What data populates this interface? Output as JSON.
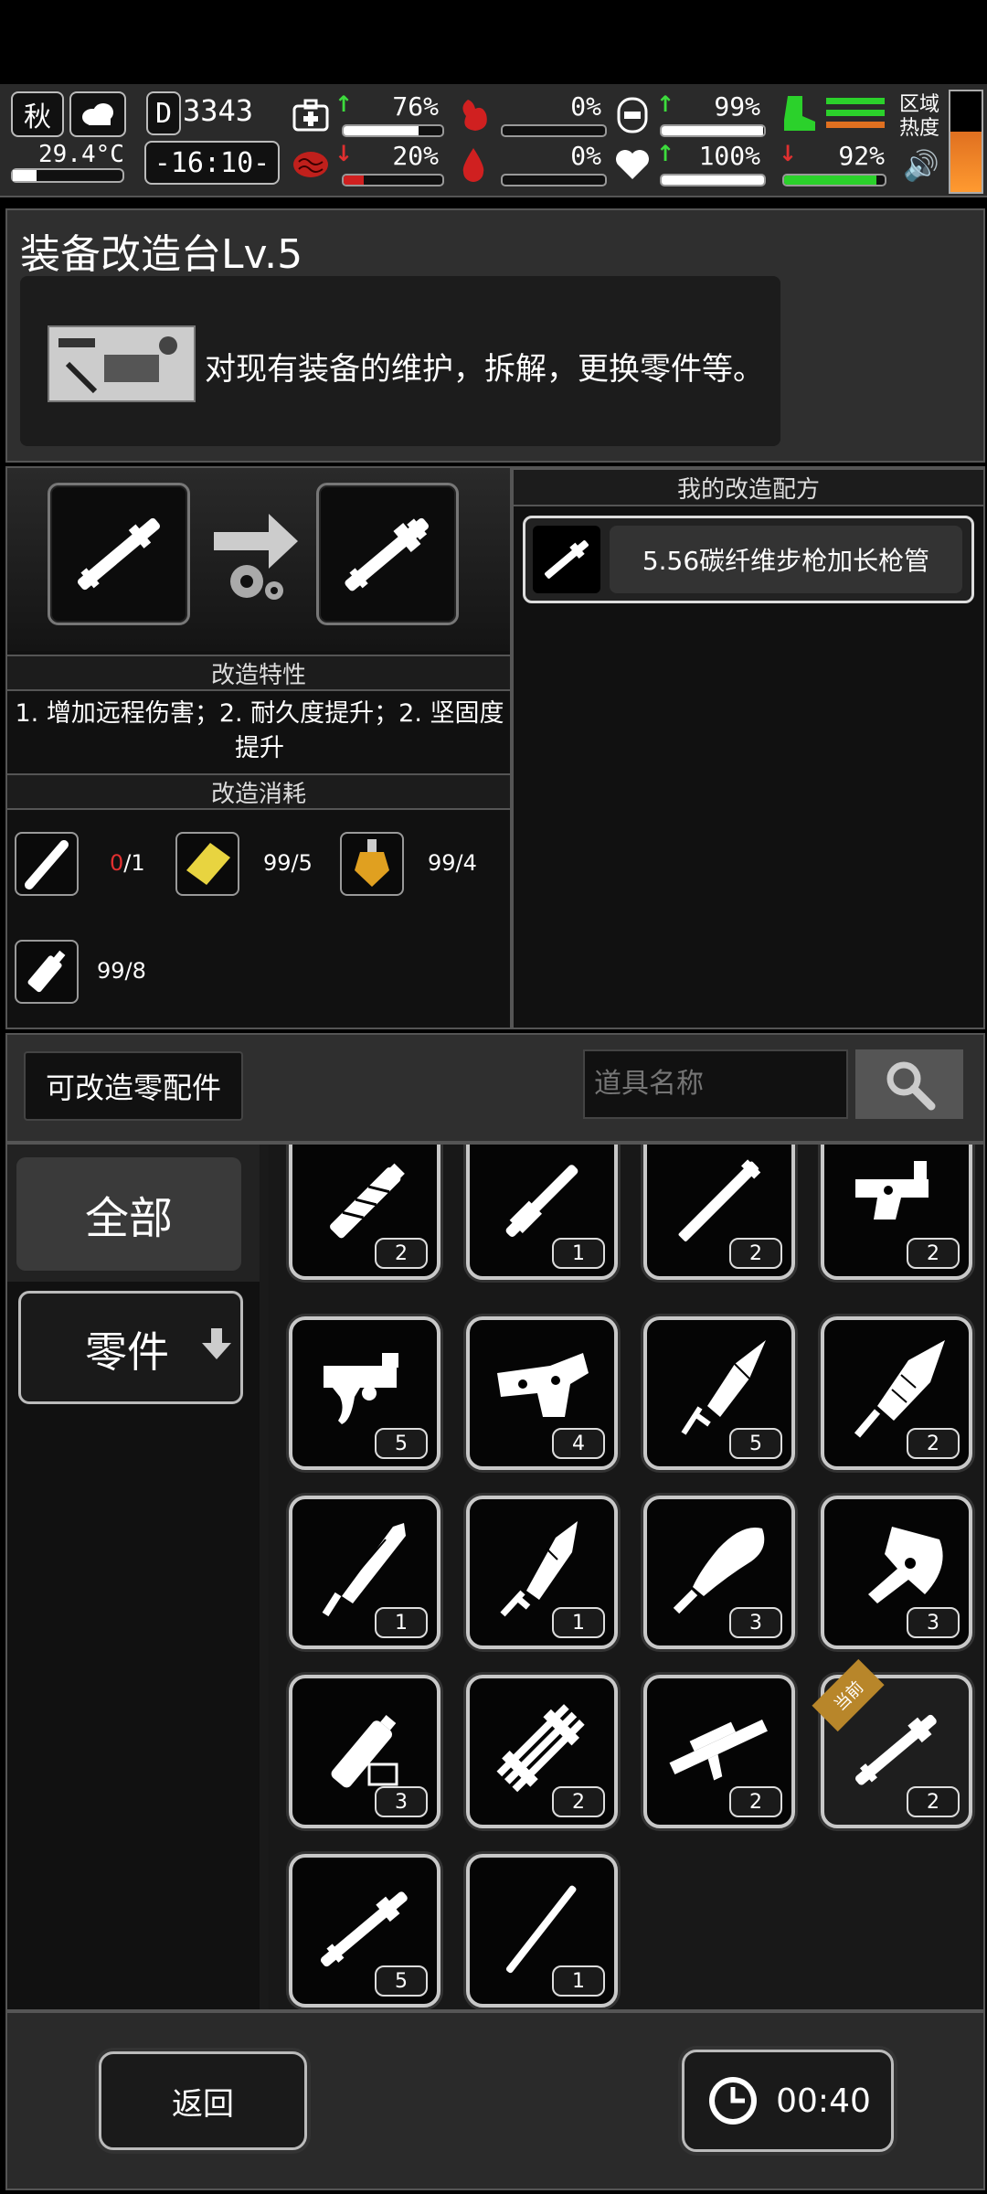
{
  "status": {
    "season": "秋",
    "temperature": "29.4°C",
    "day": "3343",
    "time": "-16:10-",
    "health_pct": "76%",
    "stomach_pct": "0%",
    "armor_pct": "99%",
    "mind_pct": "20%",
    "blood_pct": "0%",
    "heart_pct": "100%",
    "stamina_pct": "92%",
    "zone_label": "区域\n热度",
    "health_fill": 0.76,
    "mind_fill": 0.2,
    "stomach_fill": 0.0,
    "blood_fill": 0.0,
    "armor_fill": 0.99,
    "heart_fill": 1.0,
    "stamina_fill": 0.92
  },
  "page": {
    "title": "装备改造台Lv.5",
    "description": "对现有装备的维护，拆解，更换零件等。"
  },
  "mod": {
    "traits_header": "改造特性",
    "traits_text": "1. 增加远程伤害；2. 耐久度提升；2. 坚固度提升",
    "cost_header": "改造消耗",
    "costs": [
      {
        "have": "0",
        "need": "/1",
        "icon": "barrel-icon"
      },
      {
        "have": "99/5",
        "need": "",
        "icon": "gold-plate-icon"
      },
      {
        "have": "99/4",
        "need": "",
        "icon": "potion-icon"
      },
      {
        "have": "99/8",
        "need": "",
        "icon": "glue-tube-icon"
      }
    ]
  },
  "recipes": {
    "header": "我的改造配方",
    "items": [
      {
        "label": "5.56碳纤维步枪加长枪管"
      }
    ]
  },
  "parts": {
    "tab_label": "可改造零配件",
    "search_placeholder": "道具名称",
    "filter_all": "全部",
    "filter_parts": "零件",
    "current_badge": "当前",
    "items": [
      {
        "icon": "tape-wrap-icon",
        "count": "2"
      },
      {
        "icon": "rod-icon",
        "count": "1"
      },
      {
        "icon": "long-pipe-icon",
        "count": "2"
      },
      {
        "icon": "receiver-icon",
        "count": "2"
      },
      {
        "icon": "trigger-group-icon",
        "count": "5"
      },
      {
        "icon": "lower-receiver-icon",
        "count": "4"
      },
      {
        "icon": "crystal-spear-icon",
        "count": "5"
      },
      {
        "icon": "crystal-blade-icon",
        "count": "2"
      },
      {
        "icon": "dagger-icon",
        "count": "1"
      },
      {
        "icon": "crystal-sword-icon",
        "count": "1"
      },
      {
        "icon": "machete-icon",
        "count": "3"
      },
      {
        "icon": "axe-head-icon",
        "count": "3"
      },
      {
        "icon": "battery-tube-icon",
        "count": "3"
      },
      {
        "icon": "minigun-barrel-icon",
        "count": "2"
      },
      {
        "icon": "rifle-frame-icon",
        "count": "2"
      },
      {
        "icon": "barrel-extension-icon",
        "count": "2"
      },
      {
        "icon": "long-barrel-icon",
        "count": "5"
      },
      {
        "icon": "straight-rod-icon",
        "count": "1"
      }
    ]
  },
  "footer": {
    "back_label": "返回",
    "timer": "00:40"
  }
}
